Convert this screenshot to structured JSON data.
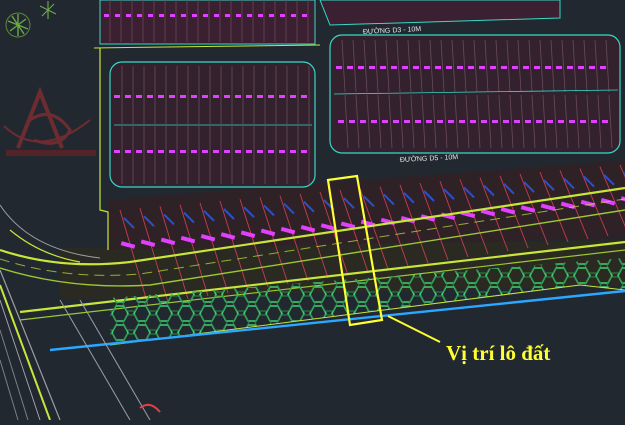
{
  "map": {
    "street_upper": "ĐƯỜNG D3 - 10M",
    "street_middle": "ĐƯỜNG D5 - 10M",
    "callout_label": "Vị trí lô đất",
    "colors": {
      "background": "#212830",
      "road_line": "#c8e639",
      "lot_fill": "#7a2448",
      "lot_line": "#e05060",
      "block_outline": "#38d8c8",
      "label_text": "#e040ff",
      "highlight": "#ffff33",
      "canal": "#2aa8ff",
      "hex_park": "#40d070"
    },
    "icons": [
      "tree-icon",
      "watermark-logo"
    ]
  }
}
